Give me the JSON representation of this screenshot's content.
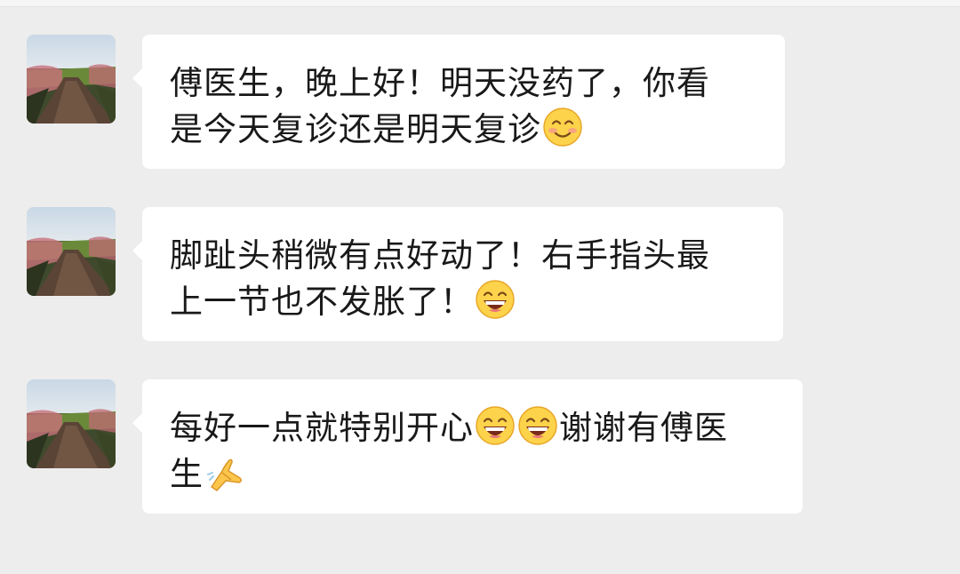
{
  "chat": {
    "messages": [
      {
        "sender": "patient",
        "lines": [
          {
            "text": "傅医生，晚上好！明天没药了，你看",
            "emojis": []
          },
          {
            "text": "是今天复诊还是明天复诊",
            "emojis": [
              "smile-blush-emoji"
            ]
          }
        ]
      },
      {
        "sender": "patient",
        "lines": [
          {
            "text": "脚趾头稍微有点好动了！右手指头最",
            "emojis": []
          },
          {
            "text": "上一节也不发胀了！",
            "emojis": [
              "grin-emoji"
            ]
          }
        ]
      },
      {
        "sender": "patient",
        "lines": [
          {
            "segments": [
              "每好一点就特别开心",
              "",
              "谢谢有傅医"
            ],
            "emojis": [
              "grin-emoji",
              "grin-emoji"
            ]
          },
          {
            "text": "生",
            "emojis": [
              "folded-hands-emoji"
            ]
          }
        ]
      }
    ]
  },
  "colors": {
    "background": "#ededed",
    "bubble": "#ffffff",
    "text": "#191919"
  }
}
